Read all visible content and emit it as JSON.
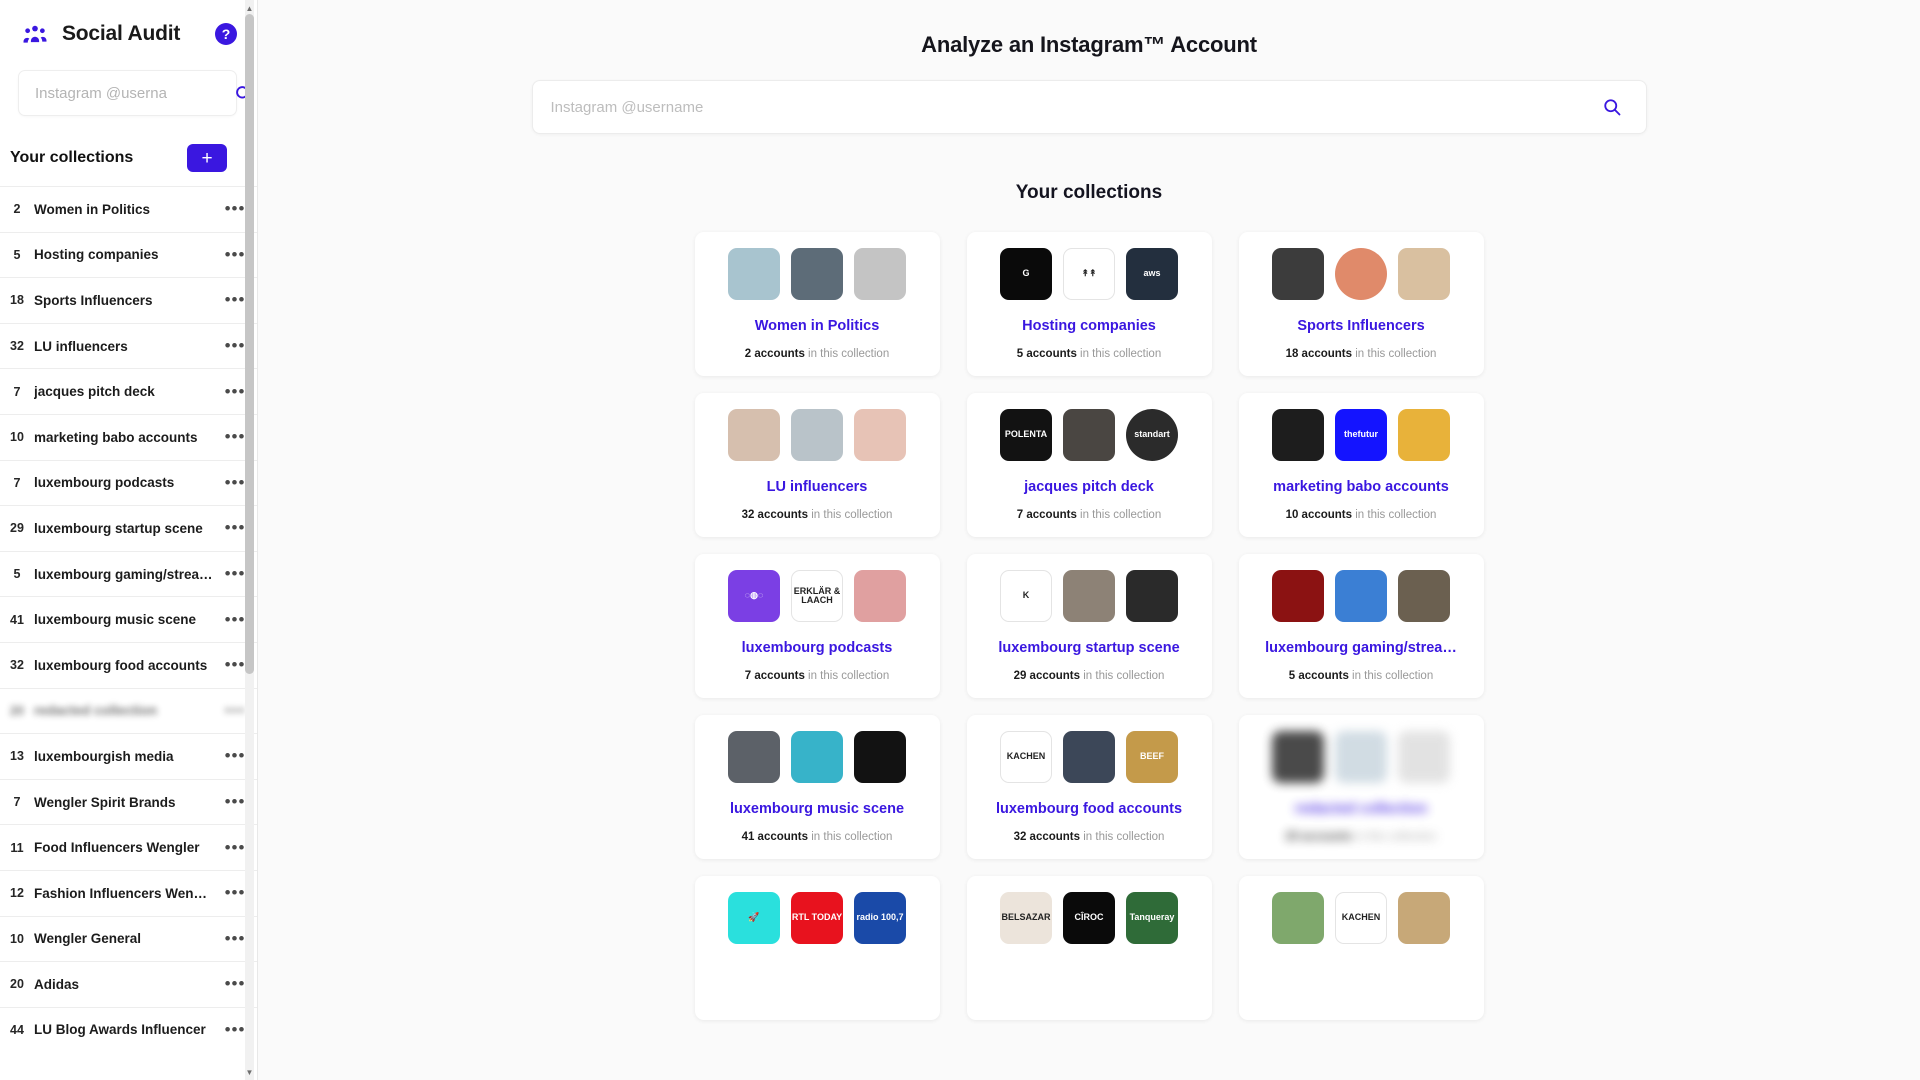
{
  "app": {
    "title": "Social Audit",
    "logo_icon": "people-group-icon",
    "help_label": "?"
  },
  "sidebar": {
    "search": {
      "placeholder": "Instagram @userna",
      "value": "",
      "icon": "search-icon"
    },
    "collections_header": {
      "title": "Your collections",
      "add_label": "+"
    },
    "menu_icon": "ellipsis-icon",
    "items": [
      {
        "count": "2",
        "label": "Women in Politics",
        "redacted": false
      },
      {
        "count": "5",
        "label": "Hosting companies",
        "redacted": false
      },
      {
        "count": "18",
        "label": "Sports Influencers",
        "redacted": false
      },
      {
        "count": "32",
        "label": "LU influencers",
        "redacted": false
      },
      {
        "count": "7",
        "label": "jacques pitch deck",
        "redacted": false
      },
      {
        "count": "10",
        "label": "marketing babo accounts",
        "redacted": false
      },
      {
        "count": "7",
        "label": "luxembourg podcasts",
        "redacted": false
      },
      {
        "count": "29",
        "label": "luxembourg startup scene",
        "redacted": false
      },
      {
        "count": "5",
        "label": "luxembourg gaming/streami…",
        "redacted": false
      },
      {
        "count": "41",
        "label": "luxembourg music scene",
        "redacted": false
      },
      {
        "count": "32",
        "label": "luxembourg food accounts",
        "redacted": false
      },
      {
        "count": "20",
        "label": "redacted collection",
        "redacted": true
      },
      {
        "count": "13",
        "label": "luxembourgish media",
        "redacted": false
      },
      {
        "count": "7",
        "label": "Wengler Spirit Brands",
        "redacted": false
      },
      {
        "count": "11",
        "label": "Food Influencers Wengler",
        "redacted": false
      },
      {
        "count": "12",
        "label": "Fashion Influencers Wengler",
        "redacted": false
      },
      {
        "count": "10",
        "label": "Wengler General",
        "redacted": false
      },
      {
        "count": "20",
        "label": "Adidas",
        "redacted": false
      },
      {
        "count": "44",
        "label": "LU Blog Awards Influencer",
        "redacted": false
      }
    ]
  },
  "main": {
    "title": "Analyze an Instagram™ Account",
    "search": {
      "placeholder": "Instagram @username",
      "value": "",
      "icon": "search-icon"
    },
    "collections_heading": "Your collections",
    "accounts_word": "accounts",
    "in_collection_text": "in this collection",
    "cards": [
      {
        "title": "Women in Politics",
        "count": "2",
        "redacted": false,
        "thumbs": [
          {
            "name": "avatar-politician-1",
            "bg": "#a8c4cf",
            "shape": "square",
            "text": ""
          },
          {
            "name": "avatar-politician-2",
            "bg": "#5d6c78",
            "shape": "square",
            "text": ""
          },
          {
            "name": "avatar-placeholder",
            "bg": "#c4c4c4",
            "shape": "square",
            "text": ""
          }
        ]
      },
      {
        "title": "Hosting companies",
        "count": "5",
        "redacted": false,
        "thumbs": [
          {
            "name": "logo-godaddy",
            "bg": "#0a0a0a",
            "shape": "square",
            "text": "G"
          },
          {
            "name": "logo-trees",
            "bg": "#ffffff",
            "shape": "square",
            "text": "↟↟"
          },
          {
            "name": "logo-aws",
            "bg": "#232f3e",
            "shape": "square",
            "text": "aws"
          }
        ]
      },
      {
        "title": "Sports Influencers",
        "count": "18",
        "redacted": false,
        "thumbs": [
          {
            "name": "avatar-athlete-1",
            "bg": "#3c3c3c",
            "shape": "square",
            "text": ""
          },
          {
            "name": "avatar-athlete-2",
            "bg": "#e08a6a",
            "shape": "circle",
            "text": ""
          },
          {
            "name": "avatar-athlete-3",
            "bg": "#d9c0a0",
            "shape": "square",
            "text": ""
          }
        ]
      },
      {
        "title": "LU influencers",
        "count": "32",
        "redacted": false,
        "thumbs": [
          {
            "name": "avatar-influencer-1",
            "bg": "#d6bfae",
            "shape": "square",
            "text": ""
          },
          {
            "name": "avatar-influencer-2",
            "bg": "#b9c3c9",
            "shape": "square",
            "text": ""
          },
          {
            "name": "avatar-influencer-3",
            "bg": "#e7c3b6",
            "shape": "square",
            "text": ""
          }
        ]
      },
      {
        "title": "jacques pitch deck",
        "count": "7",
        "redacted": false,
        "thumbs": [
          {
            "name": "logo-polenta",
            "bg": "#121212",
            "shape": "square",
            "text": "POLENTA"
          },
          {
            "name": "avatar-person",
            "bg": "#4a4642",
            "shape": "square",
            "text": ""
          },
          {
            "name": "logo-standart",
            "bg": "#2b2b2b",
            "shape": "circle",
            "text": "standart"
          }
        ]
      },
      {
        "title": "marketing babo accounts",
        "count": "10",
        "redacted": false,
        "thumbs": [
          {
            "name": "avatar-marketer-1",
            "bg": "#1d1d1d",
            "shape": "square",
            "text": ""
          },
          {
            "name": "logo-thefutur",
            "bg": "#1414ff",
            "shape": "square",
            "text": "thefutur"
          },
          {
            "name": "avatar-marketer-2",
            "bg": "#e8b23a",
            "shape": "square",
            "text": ""
          }
        ]
      },
      {
        "title": "luxembourg podcasts",
        "count": "7",
        "redacted": false,
        "thumbs": [
          {
            "name": "logo-podcast-dots",
            "bg": "#7b3fe4",
            "shape": "square",
            "text": "◌◍◌"
          },
          {
            "name": "logo-erklaer-und-lach",
            "bg": "#ffffff",
            "shape": "square",
            "text": "ERKLÄR & LAACH"
          },
          {
            "name": "logo-podcast-face",
            "bg": "#e0a0a0",
            "shape": "square",
            "text": ""
          }
        ]
      },
      {
        "title": "luxembourg startup scene",
        "count": "29",
        "redacted": false,
        "thumbs": [
          {
            "name": "logo-k-circle",
            "bg": "#ffffff",
            "shape": "square",
            "text": "K"
          },
          {
            "name": "avatar-startup-1",
            "bg": "#8d8276",
            "shape": "square",
            "text": ""
          },
          {
            "name": "avatar-startup-2",
            "bg": "#2a2a2a",
            "shape": "square",
            "text": ""
          }
        ]
      },
      {
        "title": "luxembourg gaming/strea…",
        "count": "5",
        "redacted": false,
        "thumbs": [
          {
            "name": "avatar-gamer-1",
            "bg": "#8b1212",
            "shape": "square",
            "text": ""
          },
          {
            "name": "avatar-gamer-2",
            "bg": "#3b7fd4",
            "shape": "square",
            "text": ""
          },
          {
            "name": "avatar-gamer-3",
            "bg": "#6b6050",
            "shape": "square",
            "text": ""
          }
        ]
      },
      {
        "title": "luxembourg music scene",
        "count": "41",
        "redacted": false,
        "thumbs": [
          {
            "name": "avatar-musician-1",
            "bg": "#5c6168",
            "shape": "square",
            "text": ""
          },
          {
            "name": "avatar-musician-2",
            "bg": "#37b3c9",
            "shape": "square",
            "text": ""
          },
          {
            "name": "avatar-musician-3",
            "bg": "#121212",
            "shape": "square",
            "text": ""
          }
        ]
      },
      {
        "title": "luxembourg food accounts",
        "count": "32",
        "redacted": false,
        "thumbs": [
          {
            "name": "logo-kachen",
            "bg": "#ffffff",
            "shape": "square",
            "text": "KACHEN"
          },
          {
            "name": "avatar-chef",
            "bg": "#3c4758",
            "shape": "square",
            "text": ""
          },
          {
            "name": "logo-beef-burger",
            "bg": "#c49a4a",
            "shape": "square",
            "text": "BEEF"
          }
        ]
      },
      {
        "title": "redacted collection",
        "count": "20",
        "redacted": true,
        "thumbs": [
          {
            "name": "avatar-redacted-1",
            "bg": "#2b2b2b",
            "shape": "square",
            "text": ""
          },
          {
            "name": "avatar-redacted-2",
            "bg": "#c9d6df",
            "shape": "square",
            "text": ""
          },
          {
            "name": "avatar-redacted-3",
            "bg": "#dedede",
            "shape": "square",
            "text": ""
          }
        ]
      },
      {
        "title": "",
        "count": "",
        "redacted": false,
        "partial": true,
        "thumbs": [
          {
            "name": "logo-rocket",
            "bg": "#2ae0dd",
            "shape": "square",
            "text": "🚀"
          },
          {
            "name": "logo-rtl-today",
            "bg": "#e8121e",
            "shape": "square",
            "text": "RTL TODAY"
          },
          {
            "name": "logo-radio-1007",
            "bg": "#1a4aa8",
            "shape": "square",
            "text": "radio 100,7"
          }
        ]
      },
      {
        "title": "",
        "count": "",
        "redacted": false,
        "partial": true,
        "thumbs": [
          {
            "name": "logo-belsazar",
            "bg": "#ece4db",
            "shape": "square",
            "text": "BELSAZAR"
          },
          {
            "name": "logo-ciroc",
            "bg": "#0a0a0a",
            "shape": "square",
            "text": "CÎROC"
          },
          {
            "name": "logo-tanqueray",
            "bg": "#2f6b38",
            "shape": "square",
            "text": "Tanqueray"
          }
        ]
      },
      {
        "title": "",
        "count": "",
        "redacted": false,
        "partial": true,
        "thumbs": [
          {
            "name": "avatar-food-person",
            "bg": "#7fa86c",
            "shape": "square",
            "text": ""
          },
          {
            "name": "logo-kachen-2",
            "bg": "#ffffff",
            "shape": "square",
            "text": "KACHEN"
          },
          {
            "name": "avatar-field",
            "bg": "#c7a878",
            "shape": "square",
            "text": ""
          }
        ]
      }
    ]
  },
  "colors": {
    "accent": "#3a17e0",
    "sidebar_bg": "#ffffff",
    "main_bg": "#fafafa",
    "card_bg": "#ffffff",
    "muted_text": "#999999"
  }
}
